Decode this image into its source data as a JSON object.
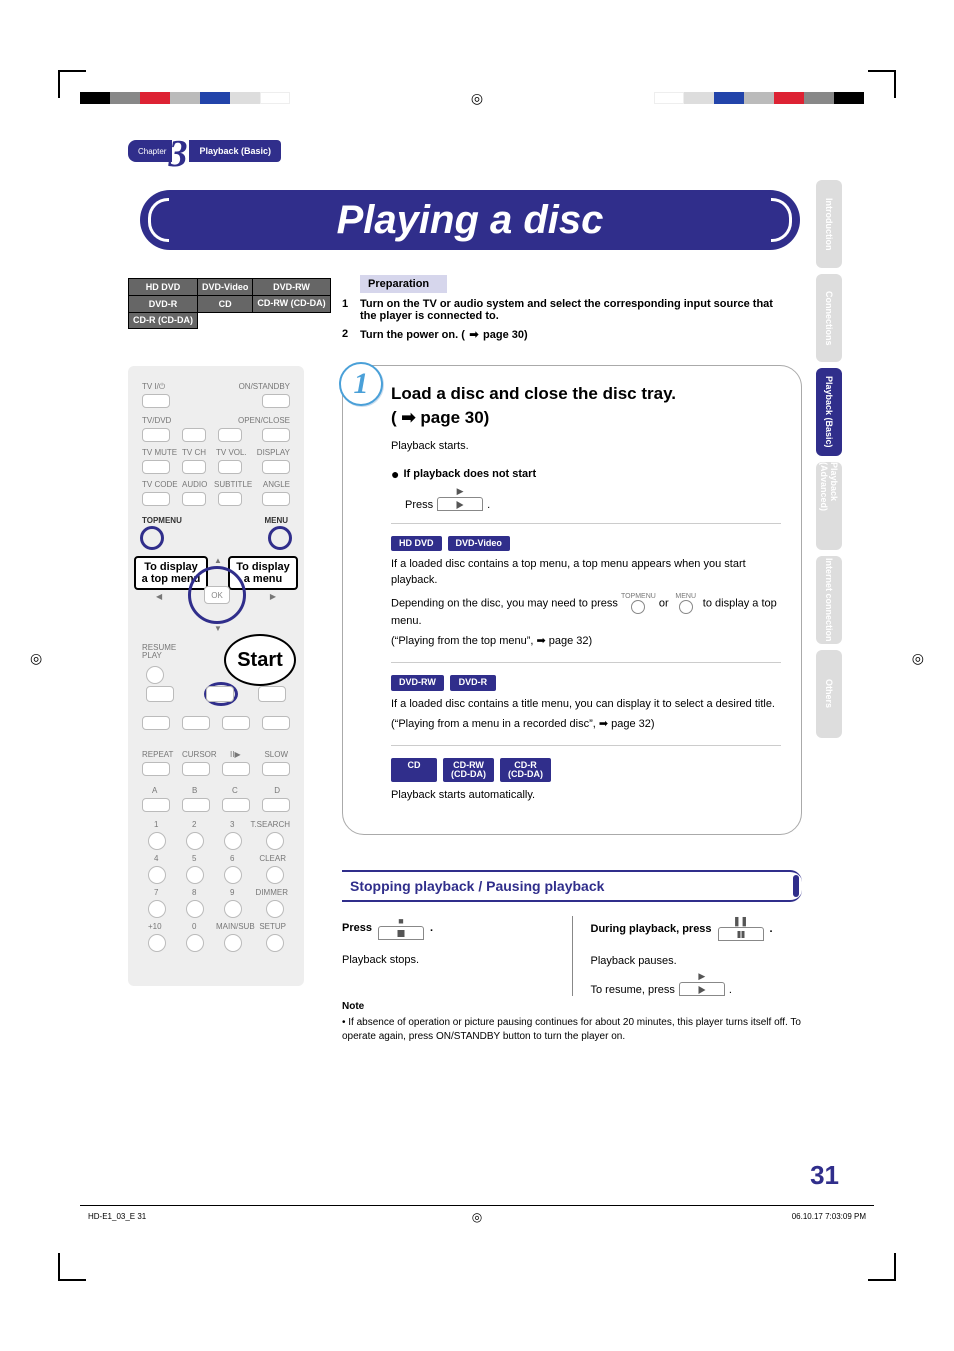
{
  "chapter": {
    "label": "Chapter",
    "number": "3",
    "name": "Playback (Basic)"
  },
  "title": "Playing a disc",
  "sideTabs": [
    {
      "label": "Introduction",
      "active": false
    },
    {
      "label": "Connections",
      "active": false
    },
    {
      "label": "Playback (Basic)",
      "active": true
    },
    {
      "label": "Playback (Advanced)",
      "active": false
    },
    {
      "label": "Internet connection",
      "active": false
    },
    {
      "label": "Others",
      "active": false
    }
  ],
  "discTable": {
    "row1": [
      "HD DVD",
      "DVD-Video",
      "DVD-RW"
    ],
    "row2": [
      "DVD-R",
      "CD",
      "CD-RW\n(CD-DA)"
    ],
    "row3": [
      "CD-R\n(CD-DA)"
    ]
  },
  "remote": {
    "labels": {
      "tvio": "TV I/⏻",
      "onstandby": "ON/STANDBY",
      "io": "I/⏻",
      "tvdvd": "TV/DVD",
      "openclose": "OPEN/CLOSE",
      "tvmute": "TV MUTE",
      "tvch": "TV CH",
      "tvvol": "TV VOL.",
      "display": "DISPLAY",
      "tvcode": "TV CODE",
      "audio": "AUDIO",
      "subtitle": "SUBTITLE",
      "angle": "ANGLE",
      "topmenu": "TOPMENU",
      "menu": "MENU",
      "ok": "OK",
      "resumeplay": "RESUME\nPLAY",
      "repeat": "REPEAT",
      "cursor": "CURSOR",
      "iistep": "II▶",
      "slow": "SLOW",
      "a": "A",
      "b": "B",
      "c": "C",
      "d": "D",
      "tsearch": "T.SEARCH",
      "clear": "CLEAR",
      "dimmer": "DIMMER",
      "mainsub": "MAIN/SUB",
      "setup": "SETUP",
      "plus10": "+10"
    },
    "callouts": {
      "topmenu": "To display a top menu",
      "menu": "To display a menu",
      "start": "Start"
    }
  },
  "preparation": {
    "heading": "Preparation",
    "items": [
      {
        "num": "1",
        "text": "Turn on the TV or audio system and select the corresponding input source that the player is connected to."
      },
      {
        "num": "2",
        "text": "Turn the power on. (",
        "pageRef": "page 30)",
        "icon": "➡"
      }
    ]
  },
  "step1": {
    "badge": "1",
    "title": "Load a disc and close the disc tray.",
    "sub": "( ➡ page 30)",
    "playbackStarts": "Playback starts.",
    "ifNotStart": "If playback does not start",
    "pressText": "Press",
    "period": ".",
    "groupA": {
      "badges": [
        "HD DVD",
        "DVD-Video"
      ],
      "line1": "If a loaded disc contains a top menu, a top menu appears when you start playback.",
      "line2a": "Depending on the disc, you may need to press",
      "topmenuLabel": "TOPMENU",
      "orText": "or",
      "menuLabel": "MENU",
      "line2b": "to display a top menu.",
      "line3": "(“Playing from the top menu”, ➡ page 32)"
    },
    "groupB": {
      "badges": [
        "DVD-RW",
        "DVD-R"
      ],
      "line1": "If a loaded disc contains a title menu, you can display it to select a desired title.",
      "line2": "(“Playing from a menu in a recorded disc”, ➡ page 32)"
    },
    "groupC": {
      "badges": [
        "CD",
        "CD-RW\n(CD-DA)",
        "CD-R\n(CD-DA)"
      ],
      "line1": "Playback starts automatically."
    }
  },
  "subsection": {
    "title": "Stopping playback / Pausing playback",
    "left": {
      "lead": "Press",
      "period": ".",
      "body": "Playback stops."
    },
    "right": {
      "lead": "During playback, press",
      "period": ".",
      "body1": "Playback pauses.",
      "body2a": "To resume, press",
      "body2b": "."
    }
  },
  "note": {
    "title": "Note",
    "text": "• If absence of operation or picture pausing continues for about 20 minutes, this player turns itself off. To operate again, press ON/STANDBY button to turn the player on."
  },
  "pageNumber": "31",
  "footer": {
    "left": "HD-E1_03_E   31",
    "right": "06.10.17   7:03:09 PM"
  }
}
